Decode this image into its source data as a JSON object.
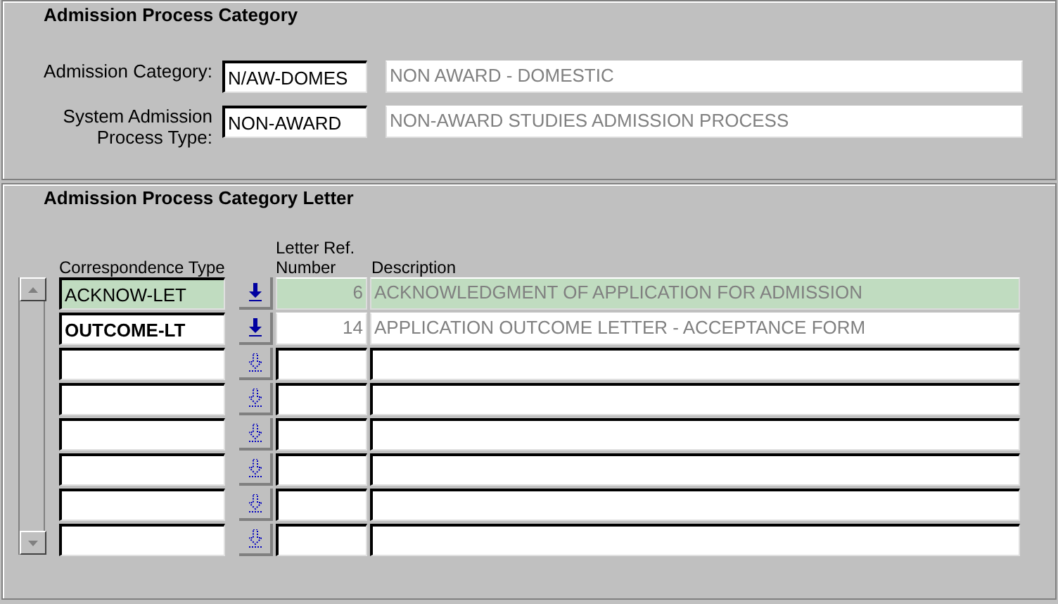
{
  "category_panel": {
    "title": "Admission Process Category",
    "fields": [
      {
        "label": "Admission Category:",
        "code": "N/AW-DOMES",
        "description": "NON AWARD - DOMESTIC"
      },
      {
        "label": "System Admission Process Type:",
        "code": "NON-AWARD",
        "description": "NON-AWARD STUDIES ADMISSION PROCESS"
      }
    ]
  },
  "letter_panel": {
    "title": "Admission Process Category Letter",
    "columns": [
      "Correspondence Type",
      "Letter Ref. Number",
      "Description"
    ],
    "rows": [
      {
        "type": "ACKNOW-LET",
        "ref": "6",
        "description": "ACKNOWLEDGMENT OF APPLICATION FOR ADMISSION",
        "selected": true,
        "current": false,
        "disabled": false
      },
      {
        "type": "OUTCOME-LT",
        "ref": "14",
        "description": "APPLICATION OUTCOME LETTER - ACCEPTANCE FORM",
        "selected": false,
        "current": true,
        "disabled": false
      },
      {
        "selected": false,
        "current": false,
        "disabled": true
      },
      {
        "selected": false,
        "current": false,
        "disabled": true
      },
      {
        "selected": false,
        "current": false,
        "disabled": true
      },
      {
        "selected": false,
        "current": false,
        "disabled": true
      },
      {
        "selected": false,
        "current": false,
        "disabled": true
      },
      {
        "selected": false,
        "current": false,
        "disabled": true
      }
    ]
  }
}
